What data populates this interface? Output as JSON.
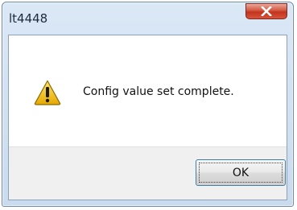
{
  "window": {
    "title": "lt4448",
    "close_icon": "close-icon"
  },
  "dialog": {
    "icon": "warning-icon",
    "message": "Config value set complete.",
    "ok_label": "OK"
  },
  "colors": {
    "titlebar": "#d4e4f5",
    "close_button": "#c9412b",
    "button_area": "#f0f0f0",
    "warning": "#f2c200"
  }
}
